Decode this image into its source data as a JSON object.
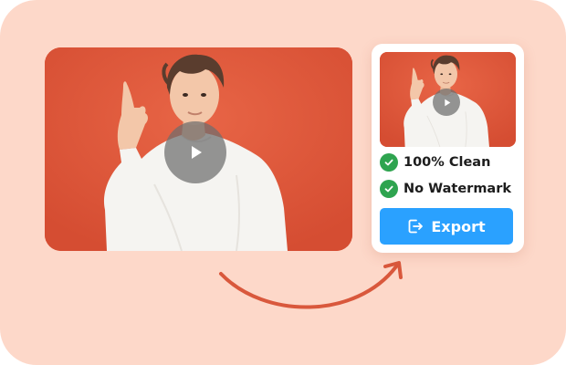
{
  "colors": {
    "background": "#fdd8c9",
    "video_background": "#e1573a",
    "accent": "#2aa1ff",
    "check": "#2ea44f",
    "arrow": "#d9583c"
  },
  "main_video": {
    "play_icon": "play-icon"
  },
  "result_card": {
    "play_icon": "play-icon",
    "features": [
      {
        "icon": "check-circle-icon",
        "label": "100% Clean"
      },
      {
        "icon": "check-circle-icon",
        "label": "No Watermark"
      }
    ],
    "export_button": {
      "icon": "export-icon",
      "label": "Export"
    }
  }
}
